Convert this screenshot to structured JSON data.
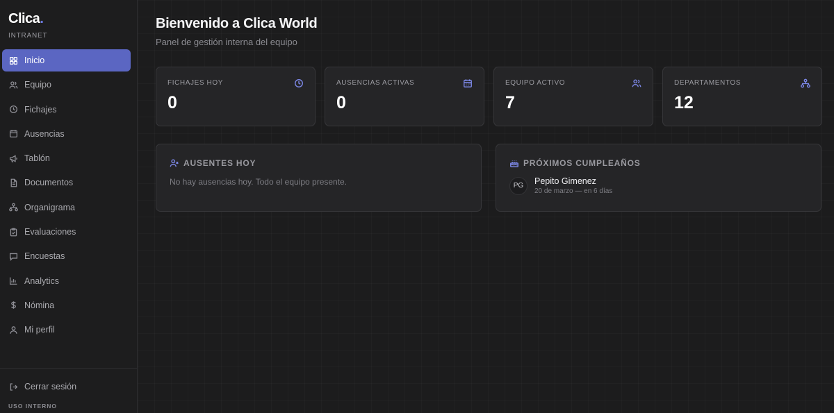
{
  "brand": {
    "name": "Clica",
    "dot": ".",
    "subtitle": "INTRANET"
  },
  "sidebar": {
    "items": [
      {
        "label": "Inicio",
        "icon": "dashboard-icon",
        "active": true
      },
      {
        "label": "Equipo",
        "icon": "users-icon"
      },
      {
        "label": "Fichajes",
        "icon": "clock-icon"
      },
      {
        "label": "Ausencias",
        "icon": "calendar-icon"
      },
      {
        "label": "Tablón",
        "icon": "megaphone-icon"
      },
      {
        "label": "Documentos",
        "icon": "document-icon"
      },
      {
        "label": "Organigrama",
        "icon": "org-chart-icon"
      },
      {
        "label": "Evaluaciones",
        "icon": "clipboard-icon"
      },
      {
        "label": "Encuestas",
        "icon": "chat-icon"
      },
      {
        "label": "Analytics",
        "icon": "bar-chart-icon"
      },
      {
        "label": "Nómina",
        "icon": "dollar-icon"
      },
      {
        "label": "Mi perfil",
        "icon": "user-icon"
      }
    ],
    "logout_label": "Cerrar sesión",
    "footer_note": "USO INTERNO"
  },
  "header": {
    "title": "Bienvenido a Clica World",
    "subtitle": "Panel de gestión interna del equipo"
  },
  "stats": [
    {
      "label": "Fichajes hoy",
      "value": "0",
      "icon": "clock-icon"
    },
    {
      "label": "Ausencias activas",
      "value": "0",
      "icon": "calendar-icon"
    },
    {
      "label": "Equipo activo",
      "value": "7",
      "icon": "users-icon"
    },
    {
      "label": "Departamentos",
      "value": "12",
      "icon": "org-chart-icon"
    }
  ],
  "absent_panel": {
    "title": "Ausentes hoy",
    "empty_text": "No hay ausencias hoy. Todo el equipo presente."
  },
  "birthday_panel": {
    "title": "Próximos cumpleaños",
    "people": [
      {
        "initials": "PG",
        "name": "Pepito Gimenez",
        "date": "20 de marzo — en 6 días"
      }
    ]
  },
  "colors": {
    "accent": "#5b66c2",
    "icon_accent": "#7c87e6",
    "background": "#1c1c1d",
    "card": "#252527"
  }
}
